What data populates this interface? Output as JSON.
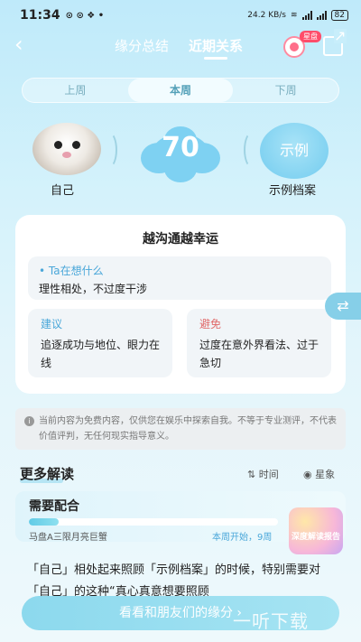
{
  "status_bar": {
    "time": "11:34",
    "net_speed": "24.2 KB/s",
    "battery": "82"
  },
  "nav": {
    "tab_inactive": "缘分总结",
    "tab_active": "近期关系",
    "badge": "星盘"
  },
  "week_tabs": [
    "上周",
    "本周",
    "下周"
  ],
  "persons": {
    "self_label": "自己",
    "score": "70",
    "example_circle": "示例",
    "example_label": "示例档案"
  },
  "card": {
    "title": "越沟通越幸运",
    "thinking_label": "Ta在想什么",
    "thinking_text": "理性相处，不过度干涉",
    "advice_label": "建议",
    "advice_text": "追逐成功与地位、眼力在线",
    "avoid_label": "避免",
    "avoid_text": "过度在意外界看法、过于急切"
  },
  "notice": "当前内容为免费内容，仅供您在娱乐中探索自我。不等于专业测评，不代表价值评判，无任何现实指导意义。",
  "more": {
    "title": "更多解读",
    "sort_time": "时间",
    "sort_star": "星象"
  },
  "reading": {
    "title": "需要配合",
    "progress": 0.12,
    "subtitle": "马盘A三限月亮巨蟹",
    "right_text": "本周开始，9周",
    "promo_text": "深度解读报告"
  },
  "body_text": "「自己」相处起来照顾「示例档案」的时候，特别需要对「自己」的这种“真心真意想要照顾",
  "cta": "看看和朋友们的缘分 ›",
  "watermark": "一听下载",
  "colors": {
    "accent": "#4aa7d9",
    "advice": "#4aa7d9",
    "avoid": "#e06a6a"
  }
}
